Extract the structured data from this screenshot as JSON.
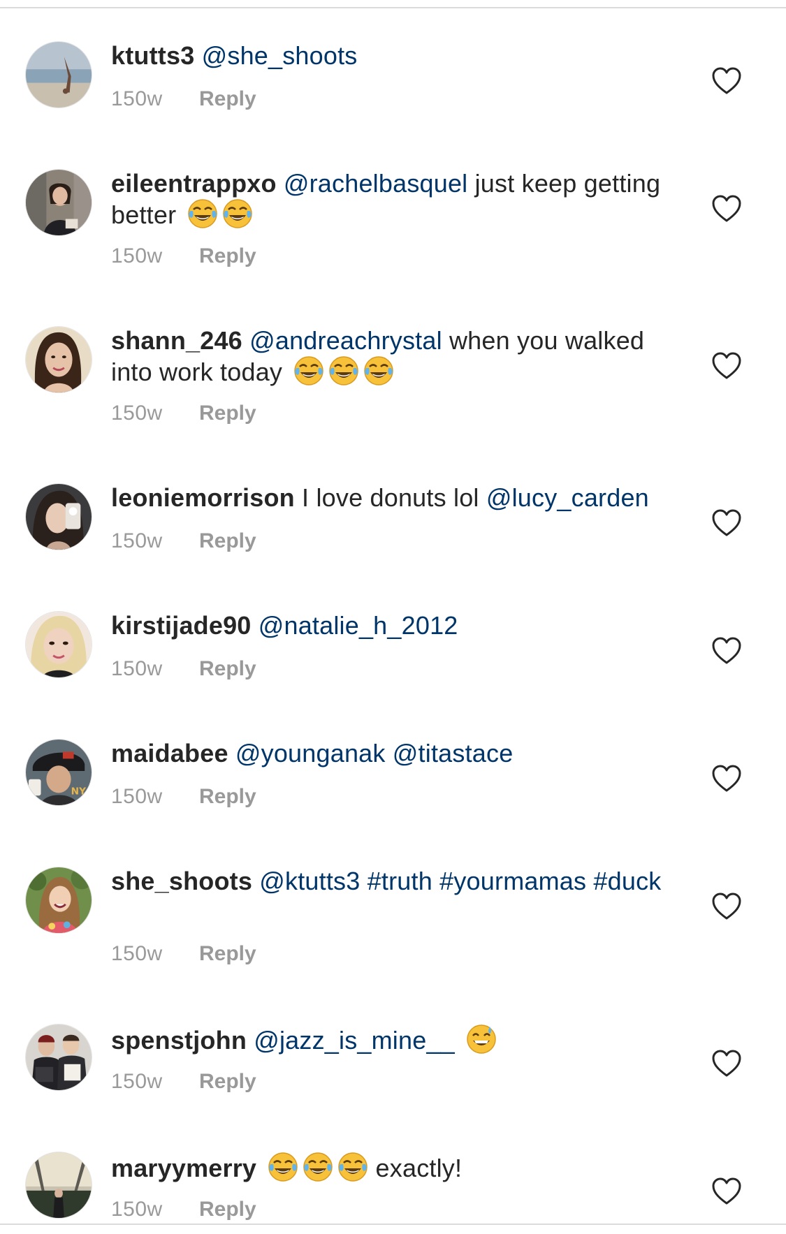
{
  "comments": [
    {
      "user": "ktutts3",
      "parts": [
        {
          "type": "mention",
          "text": "@she_shoots"
        }
      ],
      "age": "150w",
      "reply_label": "Reply"
    },
    {
      "user": "eileentrappxo",
      "parts": [
        {
          "type": "mention",
          "text": "@rachelbasquel"
        },
        {
          "type": "text",
          "text": " just keep getting better "
        },
        {
          "type": "emoji",
          "name": "tears-of-joy"
        },
        {
          "type": "emoji",
          "name": "tears-of-joy"
        }
      ],
      "age": "150w",
      "reply_label": "Reply"
    },
    {
      "user": "shann_246",
      "parts": [
        {
          "type": "mention",
          "text": "@andreachrystal"
        },
        {
          "type": "text",
          "text": " when you walked into work today "
        },
        {
          "type": "emoji",
          "name": "tears-of-joy"
        },
        {
          "type": "emoji",
          "name": "tears-of-joy"
        },
        {
          "type": "emoji",
          "name": "tears-of-joy"
        }
      ],
      "age": "150w",
      "reply_label": "Reply"
    },
    {
      "user": "leoniemorrison",
      "parts": [
        {
          "type": "text",
          "text": " I love donuts lol "
        },
        {
          "type": "mention",
          "text": "@lucy_carden"
        }
      ],
      "age": "150w",
      "reply_label": "Reply"
    },
    {
      "user": "kirstijade90",
      "parts": [
        {
          "type": "mention",
          "text": "@natalie_h_2012"
        }
      ],
      "age": "150w",
      "reply_label": "Reply"
    },
    {
      "user": "maidabee",
      "parts": [
        {
          "type": "mention",
          "text": "@younganak"
        },
        {
          "type": "text",
          "text": " "
        },
        {
          "type": "mention",
          "text": "@titastace"
        }
      ],
      "age": "150w",
      "reply_label": "Reply"
    },
    {
      "user": "she_shoots",
      "parts": [
        {
          "type": "mention",
          "text": "@ktutts3"
        },
        {
          "type": "text",
          "text": " "
        },
        {
          "type": "mention",
          "text": "#truth"
        },
        {
          "type": "text",
          "text": " "
        },
        {
          "type": "mention",
          "text": "#yourmamas"
        },
        {
          "type": "text",
          "text": " "
        },
        {
          "type": "mention",
          "text": "#duck"
        }
      ],
      "age": "150w",
      "reply_label": "Reply"
    },
    {
      "user": "spenstjohn",
      "parts": [
        {
          "type": "mention",
          "text": "@jazz_is_mine__"
        },
        {
          "type": "text",
          "text": " "
        },
        {
          "type": "emoji",
          "name": "grinning-sweat"
        }
      ],
      "age": "150w",
      "reply_label": "Reply"
    },
    {
      "user": "maryymerry",
      "parts": [
        {
          "type": "text",
          "text": " "
        },
        {
          "type": "emoji",
          "name": "tears-of-joy"
        },
        {
          "type": "emoji",
          "name": "tears-of-joy"
        },
        {
          "type": "emoji",
          "name": "tears-of-joy"
        },
        {
          "type": "text",
          "text": " exactly!"
        }
      ],
      "age": "150w",
      "reply_label": "Reply"
    }
  ],
  "icons": {
    "like": "heart-outline-icon",
    "emoji_tears_of_joy": "face-with-tears-of-joy",
    "emoji_grinning_sweat": "grinning-face-with-sweat"
  },
  "colors": {
    "username": "#262626",
    "mention": "#003569",
    "meta": "#999999",
    "heart_stroke": "#262626",
    "divider": "#dbdbdb"
  }
}
